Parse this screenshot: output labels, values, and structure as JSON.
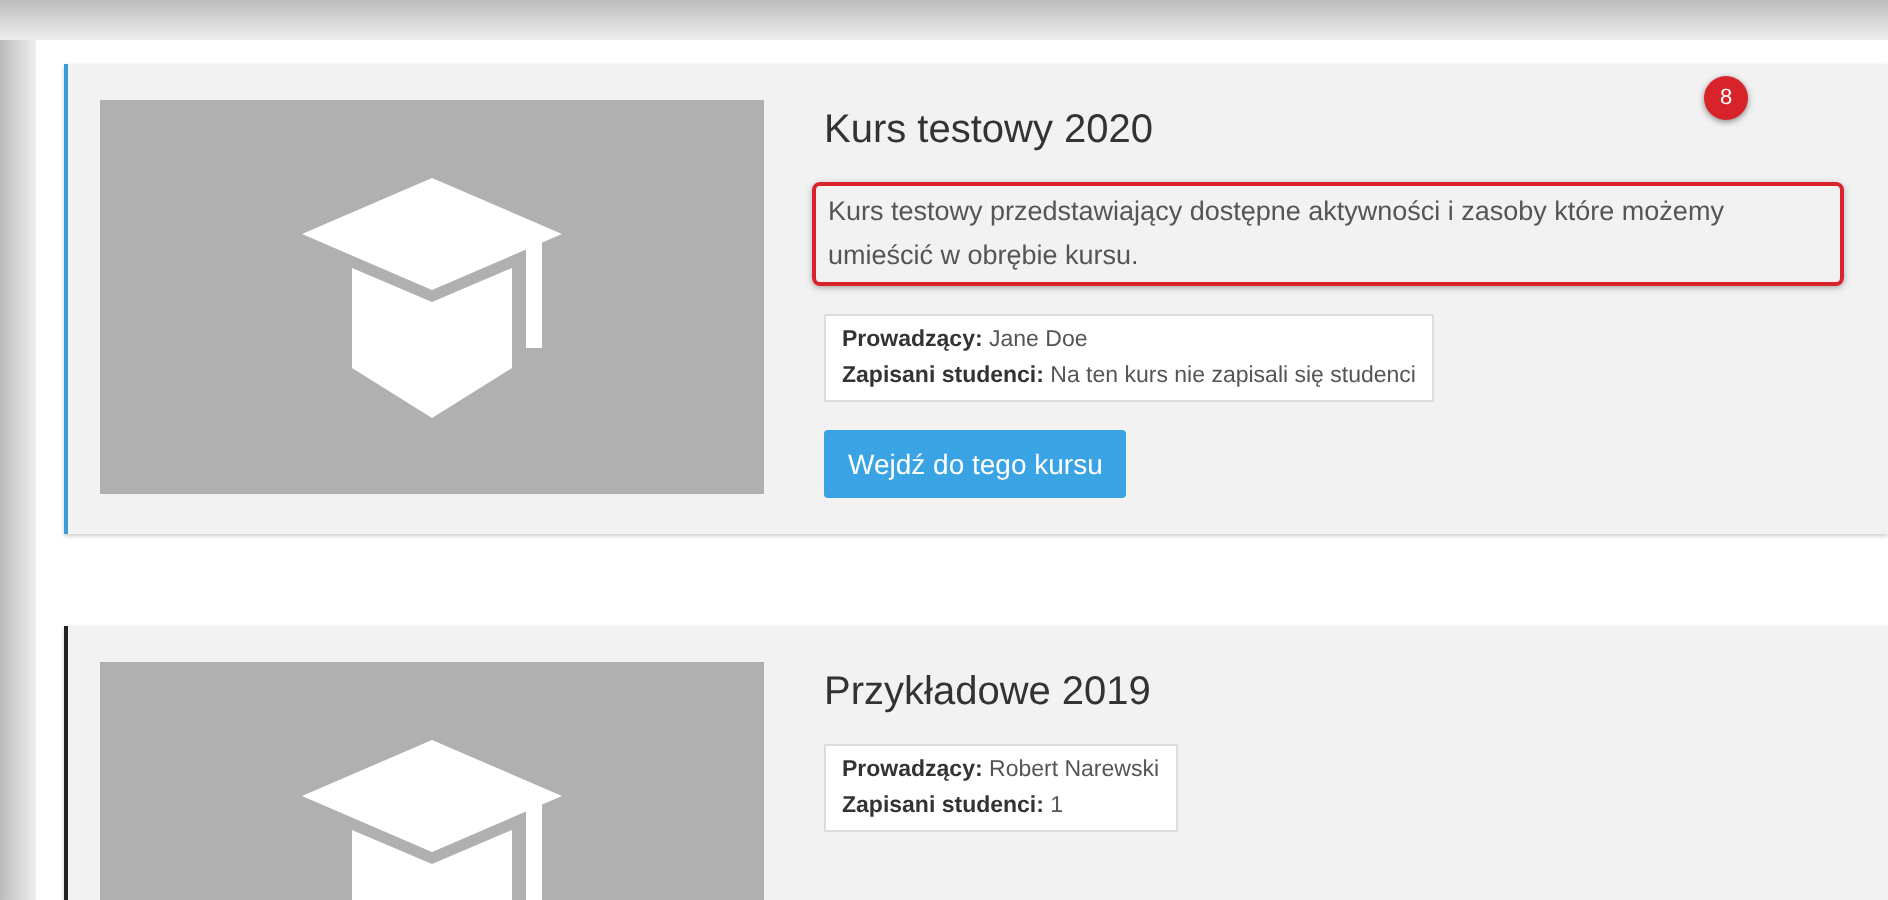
{
  "courses": [
    {
      "title": "Kurs testowy 2020",
      "badge": "8",
      "description": "Kurs testowy przedstawiający dostępne aktywności i zasoby które możemy umieścić w obrębie kursu.",
      "description_highlighted": true,
      "color": "#3a9bd9",
      "info": [
        {
          "label": "Prowadzący:",
          "value": "Jane Doe"
        },
        {
          "label": "Zapisani studenci:",
          "value": "Na ten kurs nie zapisali się studenci"
        }
      ],
      "button": "Wejdź do tego kursu"
    },
    {
      "title": "Przykładowe 2019",
      "color": "#222222",
      "info": [
        {
          "label": "Prowadzący:",
          "value": "Robert Narewski"
        },
        {
          "label": "Zapisani studenci:",
          "value": "1"
        }
      ]
    }
  ]
}
